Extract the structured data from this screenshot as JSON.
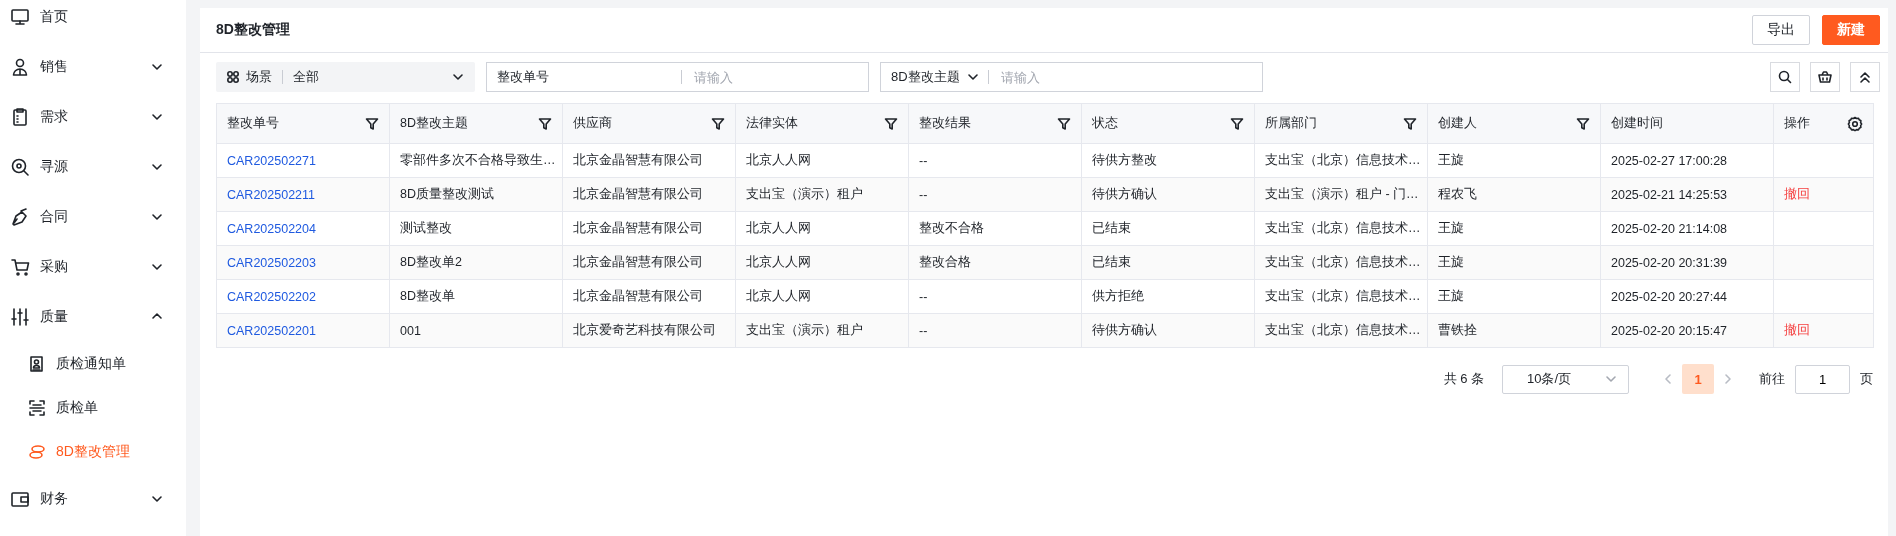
{
  "sidebar": {
    "items": [
      {
        "label": "首页",
        "kind": "link",
        "selected": false
      },
      {
        "label": "销售",
        "kind": "group",
        "expanded": false,
        "selected": false
      },
      {
        "label": "需求",
        "kind": "group",
        "expanded": false,
        "selected": false
      },
      {
        "label": "寻源",
        "kind": "group",
        "expanded": false,
        "selected": false
      },
      {
        "label": "合同",
        "kind": "group",
        "expanded": false,
        "selected": false
      },
      {
        "label": "采购",
        "kind": "group",
        "expanded": false,
        "selected": false
      },
      {
        "label": "质量",
        "kind": "group",
        "expanded": true,
        "selected": false,
        "children": [
          {
            "label": "质检通知单",
            "selected": false
          },
          {
            "label": "质检单",
            "selected": false
          },
          {
            "label": "8D整改管理",
            "selected": true
          }
        ]
      },
      {
        "label": "财务",
        "kind": "group",
        "expanded": false,
        "selected": false
      }
    ]
  },
  "page": {
    "title": "8D整改管理",
    "buttons": [
      {
        "label": "导出",
        "kind": "default"
      },
      {
        "label": "新建",
        "kind": "primary"
      }
    ]
  },
  "filters": {
    "scene": {
      "label": "场景",
      "value": "全部"
    },
    "fields": [
      {
        "label": "整改单号",
        "kind": "text",
        "placeholder": "请输入"
      },
      {
        "label": "8D整改主题",
        "kind": "dropdown",
        "placeholder": "请输入"
      }
    ]
  },
  "table": {
    "columns": [
      {
        "label": "整改单号",
        "kind": "link",
        "filter": true
      },
      {
        "label": "8D整改主题",
        "kind": "text",
        "filter": true
      },
      {
        "label": "供应商",
        "kind": "text",
        "filter": true
      },
      {
        "label": "法律实体",
        "kind": "text",
        "filter": true
      },
      {
        "label": "整改结果",
        "kind": "text",
        "filter": true
      },
      {
        "label": "状态",
        "kind": "text",
        "filter": true
      },
      {
        "label": "所属部门",
        "kind": "text",
        "filter": true
      },
      {
        "label": "创建人",
        "kind": "text",
        "filter": true
      },
      {
        "label": "创建时间",
        "kind": "text",
        "filter": false
      },
      {
        "label": "操作",
        "kind": "actions",
        "filter": false
      }
    ],
    "rows": [
      {
        "cells": [
          "CAR202502271",
          "零部件多次不合格导致生…",
          "北京金晶智慧有限公司",
          "北京人人网",
          "--",
          "待供方整改",
          "支出宝（北京）信息技术…",
          "王旋",
          "2025-02-27 17:00:28"
        ]
      },
      {
        "cells": [
          "CAR202502211",
          "8D质量整改测试",
          "北京金晶智慧有限公司",
          "支出宝（演示）租户",
          "--",
          "待供方确认",
          "支出宝（演示）租户 - 门…",
          "程农飞",
          "2025-02-21 14:25:53"
        ],
        "action": "撤回"
      },
      {
        "cells": [
          "CAR202502204",
          "测试整改",
          "北京金晶智慧有限公司",
          "北京人人网",
          "整改不合格",
          "已结束",
          "支出宝（北京）信息技术…",
          "王旋",
          "2025-02-20 21:14:08"
        ]
      },
      {
        "cells": [
          "CAR202502203",
          "8D整改单2",
          "北京金晶智慧有限公司",
          "北京人人网",
          "整改合格",
          "已结束",
          "支出宝（北京）信息技术…",
          "王旋",
          "2025-02-20 20:31:39"
        ]
      },
      {
        "cells": [
          "CAR202502202",
          "8D整改单",
          "北京金晶智慧有限公司",
          "北京人人网",
          "--",
          "供方拒绝",
          "支出宝（北京）信息技术…",
          "王旋",
          "2025-02-20 20:27:44"
        ]
      },
      {
        "cells": [
          "CAR202502201",
          "001",
          "北京爱奇艺科技有限公司",
          "支出宝（演示）租户",
          "--",
          "待供方确认",
          "支出宝（北京）信息技术…",
          "曹铁拴",
          "2025-02-20 20:15:47"
        ],
        "action": "撤回"
      }
    ]
  },
  "pagination": {
    "total": "共 6 条",
    "page_size": "10条/页",
    "pages": [
      {
        "label": "1",
        "selected": true
      }
    ],
    "goto_label": "前往",
    "goto_value": "1",
    "goto_suffix": "页"
  }
}
